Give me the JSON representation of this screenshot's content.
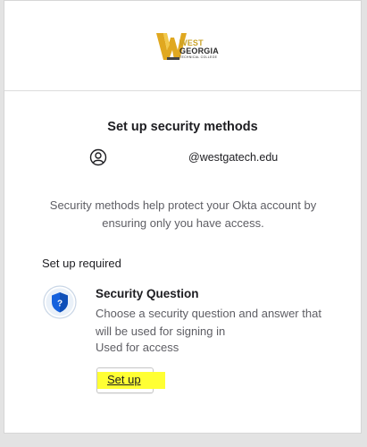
{
  "header": {
    "logo": {
      "line1": "WEST",
      "line2": "GEORGIA",
      "line3": "TECHNICAL COLLEGE",
      "brand_color": "#c9a227"
    }
  },
  "page": {
    "title": "Set up security methods",
    "user_icon": "user-circle-icon",
    "user_email": "@westgatech.edu",
    "description": "Security methods help protect your Okta account by ensuring only you have access."
  },
  "required": {
    "label": "Set up required",
    "methods": [
      {
        "icon": "security-question-shield-icon",
        "title": "Security Question",
        "description": "Choose a security question and answer that will be used for signing in",
        "usage": "Used for access",
        "button_label": "Set up",
        "highlight_color": "#ffff33"
      }
    ]
  }
}
